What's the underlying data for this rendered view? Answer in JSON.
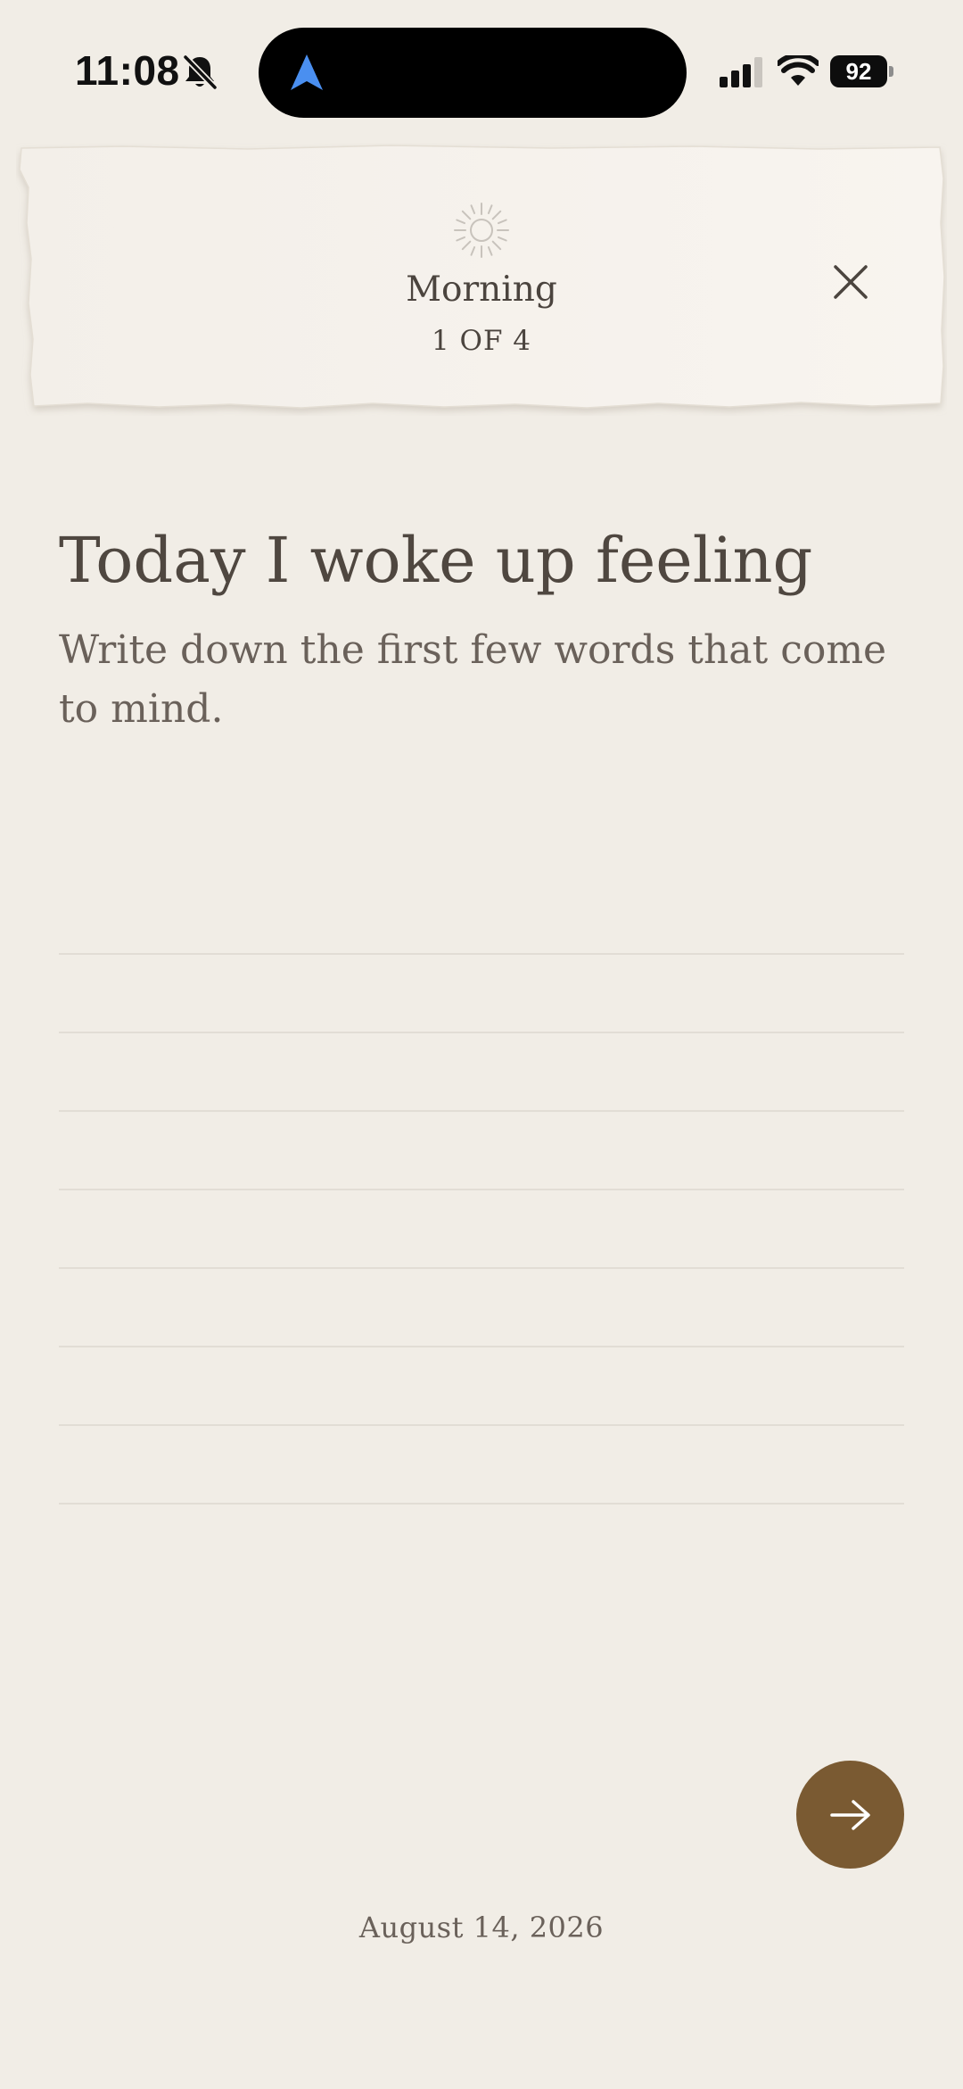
{
  "status_bar": {
    "time": "11:08",
    "battery": "92",
    "icons": [
      "bell-slash-icon",
      "navigation-arrow-icon",
      "cellular-signal-icon",
      "wifi-icon",
      "battery-icon"
    ]
  },
  "header": {
    "icon": "sun-icon",
    "title": "Morning",
    "step": "1 OF 4",
    "close_icon": "close-icon"
  },
  "prompt": {
    "title": "Today I woke up feeling",
    "hint": "Write down the first few words that come to mind."
  },
  "entry": {
    "value": ""
  },
  "next_button": {
    "icon": "arrow-right-icon"
  },
  "footer": {
    "date": "August 14, 2026"
  },
  "colors": {
    "background": "#f1ede6",
    "paper": "#f6f2ec",
    "text": "#4f4740",
    "accent": "#7a5a32",
    "nav_arrow": "#4a8ff0"
  }
}
